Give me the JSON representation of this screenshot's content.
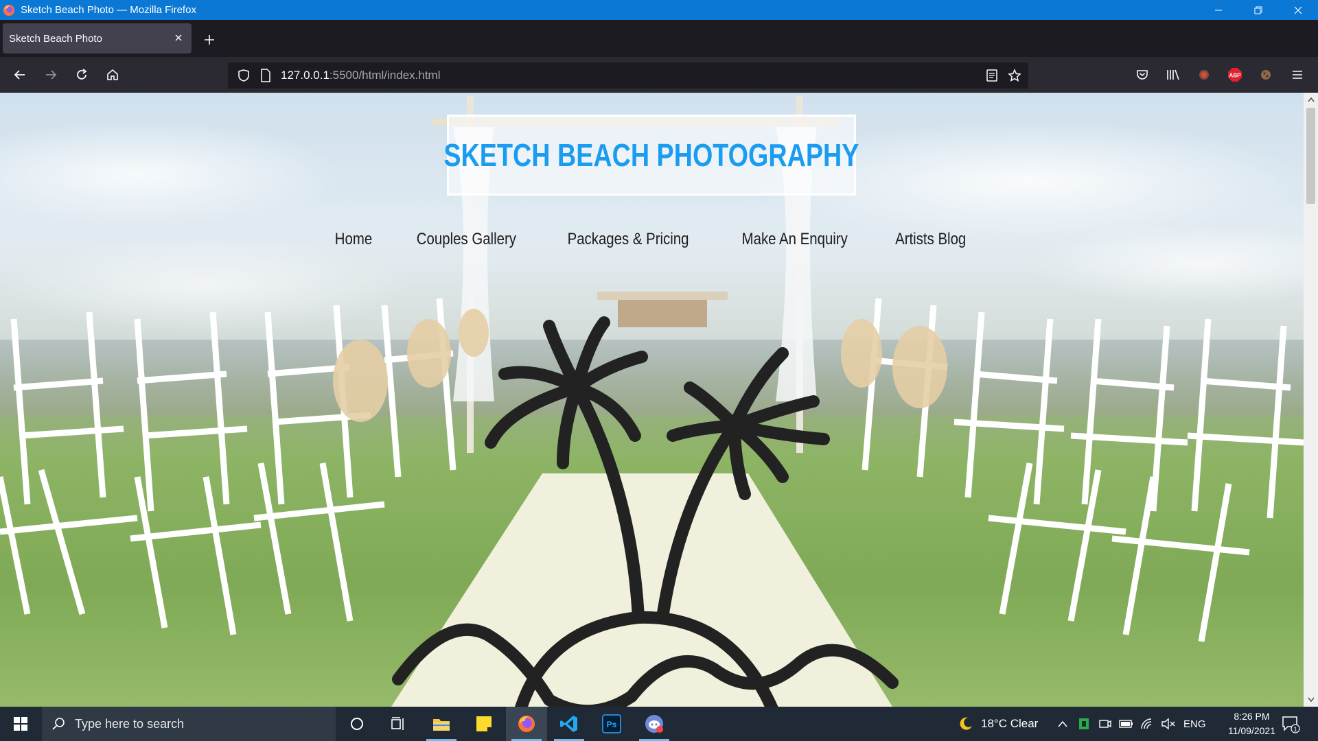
{
  "window": {
    "title": "Sketch Beach Photo — Mozilla Firefox",
    "controls": [
      "minimize-icon",
      "restore-icon",
      "close-icon"
    ]
  },
  "tabs": [
    {
      "label": "Sketch Beach Photo",
      "active": true
    }
  ],
  "urlbar": {
    "host": "127.0.0.1",
    "path": ":5500/html/index.html"
  },
  "page": {
    "logo": "SKETCH BEACH PHOTOGRAPHY",
    "nav": [
      "Home",
      "Couples Gallery",
      "Packages & Pricing",
      "Make An Enquiry",
      "Artists Blog"
    ],
    "accent_color": "#1a9cf0"
  },
  "taskbar": {
    "search_placeholder": "Type here to search",
    "weather": "18°C  Clear",
    "language": "ENG",
    "time": "8:26 PM",
    "date": "11/09/2021",
    "notification_count": "1",
    "apps": [
      "cortana-icon",
      "task-view-icon",
      "file-explorer-icon",
      "sticky-notes-icon",
      "firefox-icon",
      "vscode-icon",
      "photoshop-icon",
      "discord-icon"
    ]
  }
}
